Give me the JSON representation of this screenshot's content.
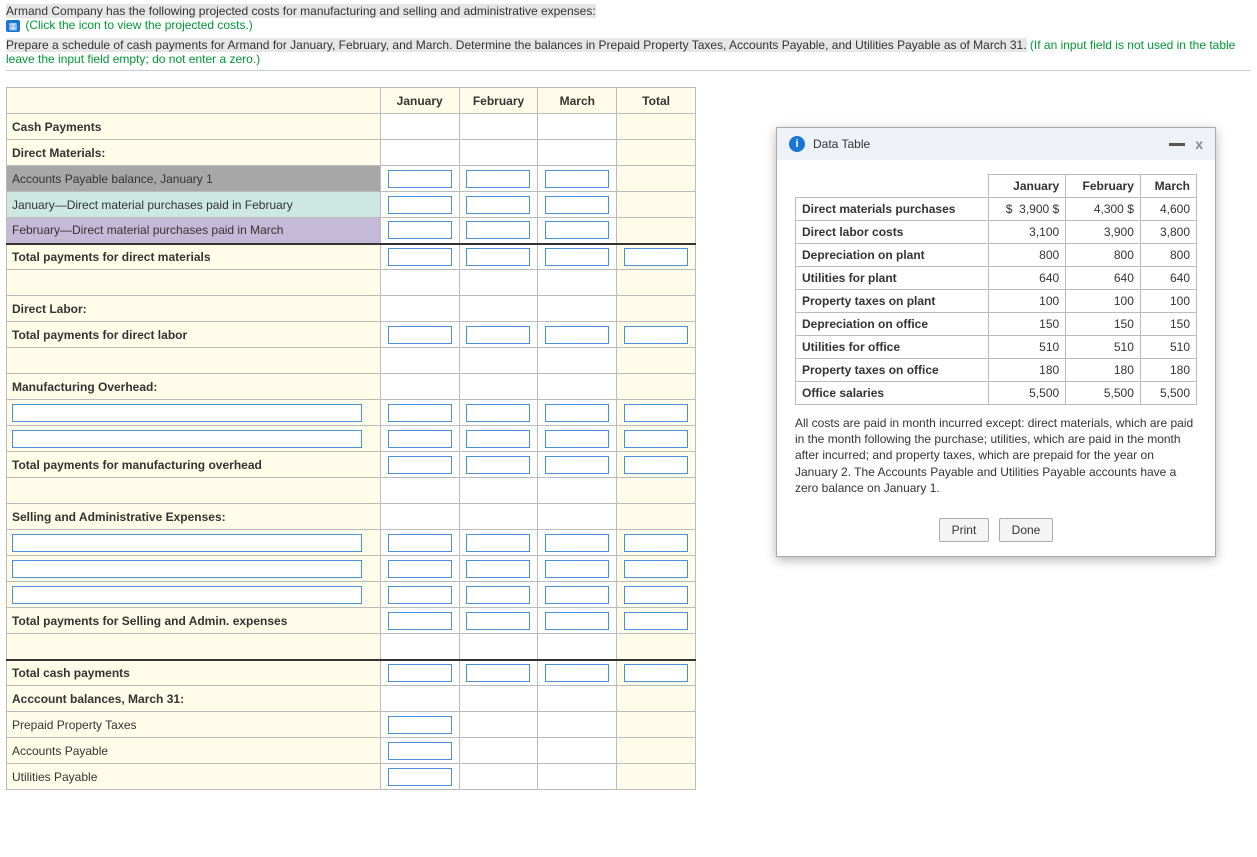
{
  "intro": {
    "line1": "Armand Company has the following projected costs for manufacturing and selling and administrative expenses:",
    "link": "(Click the icon to view the projected costs.)",
    "line2a": "Prepare a schedule of cash payments for Armand for January, February, and March. Determine the balances in Prepaid Property Taxes, Accounts Payable, and Utilities Payable as of March 31.",
    "line2b": "(If an input field is not used in the table leave the input field empty; do not enter a zero.)"
  },
  "schedule": {
    "cols": {
      "jan": "January",
      "feb": "February",
      "mar": "March",
      "tot": "Total"
    },
    "rows": {
      "cash_payments": "Cash Payments",
      "direct_materials_hdr": "Direct Materials:",
      "ap_jan1": "Accounts Payable balance, January 1",
      "jan_dm_feb": "January—Direct material purchases paid in February",
      "feb_dm_mar": "February—Direct material purchases paid in March",
      "tot_dm": "Total payments for direct materials",
      "direct_labor_hdr": "Direct Labor:",
      "tot_dl": "Total payments for direct labor",
      "moh_hdr": "Manufacturing Overhead:",
      "tot_moh": "Total payments for manufacturing overhead",
      "sga_hdr": "Selling and Administrative Expenses:",
      "tot_sga": "Total payments for Selling and Admin. expenses",
      "tot_cash": "Total cash payments",
      "acct_bal_hdr": "Acccount balances, March 31:",
      "prepaid_pt": "Prepaid Property Taxes",
      "ap": "Accounts Payable",
      "up": "Utilities Payable"
    }
  },
  "modal": {
    "title": "Data Table",
    "cols": {
      "jan": "January",
      "feb": "February",
      "mar": "March"
    },
    "currency": "$",
    "rows": [
      {
        "label": "Direct materials purchases",
        "jan": "3,900",
        "feb": "4,300",
        "mar": "4,600"
      },
      {
        "label": "Direct labor costs",
        "jan": "3,100",
        "feb": "3,900",
        "mar": "3,800"
      },
      {
        "label": "Depreciation on plant",
        "jan": "800",
        "feb": "800",
        "mar": "800"
      },
      {
        "label": "Utilities for plant",
        "jan": "640",
        "feb": "640",
        "mar": "640"
      },
      {
        "label": "Property taxes on plant",
        "jan": "100",
        "feb": "100",
        "mar": "100"
      },
      {
        "label": "Depreciation on office",
        "jan": "150",
        "feb": "150",
        "mar": "150"
      },
      {
        "label": "Utilities for office",
        "jan": "510",
        "feb": "510",
        "mar": "510"
      },
      {
        "label": "Property taxes on office",
        "jan": "180",
        "feb": "180",
        "mar": "180"
      },
      {
        "label": "Office salaries",
        "jan": "5,500",
        "feb": "5,500",
        "mar": "5,500"
      }
    ],
    "note": "All costs are paid in month incurred except: direct materials, which are paid in the month following the purchase; utilities, which are paid in the month after incurred; and property taxes, which are prepaid for the year on January 2. The Accounts Payable and Utilities Payable accounts have a zero balance on January 1.",
    "print_label": "Print",
    "done_label": "Done"
  },
  "chart_data": {
    "type": "table",
    "title": "Projected costs by month",
    "columns": [
      "January",
      "February",
      "March"
    ],
    "series": [
      {
        "name": "Direct materials purchases",
        "values": [
          3900,
          4300,
          4600
        ]
      },
      {
        "name": "Direct labor costs",
        "values": [
          3100,
          3900,
          3800
        ]
      },
      {
        "name": "Depreciation on plant",
        "values": [
          800,
          800,
          800
        ]
      },
      {
        "name": "Utilities for plant",
        "values": [
          640,
          640,
          640
        ]
      },
      {
        "name": "Property taxes on plant",
        "values": [
          100,
          100,
          100
        ]
      },
      {
        "name": "Depreciation on office",
        "values": [
          150,
          150,
          150
        ]
      },
      {
        "name": "Utilities for office",
        "values": [
          510,
          510,
          510
        ]
      },
      {
        "name": "Property taxes on office",
        "values": [
          180,
          180,
          180
        ]
      },
      {
        "name": "Office salaries",
        "values": [
          5500,
          5500,
          5500
        ]
      }
    ]
  }
}
